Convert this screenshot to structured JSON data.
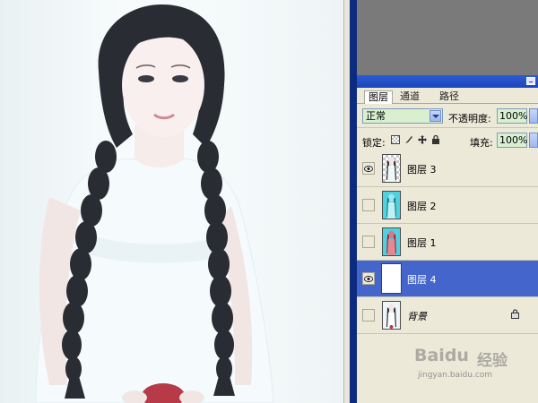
{
  "panel": {
    "tabs": [
      {
        "label": "图层"
      },
      {
        "label": "通道"
      },
      {
        "label": "路径"
      }
    ],
    "blend_mode": "正常",
    "opacity_label": "不透明度:",
    "opacity_value": "100%",
    "lock_label": "锁定:",
    "fill_label": "填充:",
    "fill_value": "100%"
  },
  "layers": [
    {
      "name": "图层 3",
      "visible": true,
      "selected": false,
      "thumb": "checker-figure"
    },
    {
      "name": "图层 2",
      "visible": false,
      "selected": false,
      "thumb": "cyan-figure"
    },
    {
      "name": "图层 1",
      "visible": false,
      "selected": false,
      "thumb": "cyan-figure-red"
    },
    {
      "name": "图层 4",
      "visible": true,
      "selected": true,
      "thumb": "white"
    },
    {
      "name": "背景",
      "visible": false,
      "selected": false,
      "thumb": "photo",
      "locked": true
    }
  ],
  "watermark": {
    "brand": "Bai",
    "brand2": "du",
    "product": "经验",
    "url": "jingyan.baidu.com"
  },
  "colors": {
    "panel_bg": "#ece9d8",
    "selected_row": "#4466cc",
    "title_bar": "#1d47b8",
    "workspace": "#7a7a7a"
  }
}
